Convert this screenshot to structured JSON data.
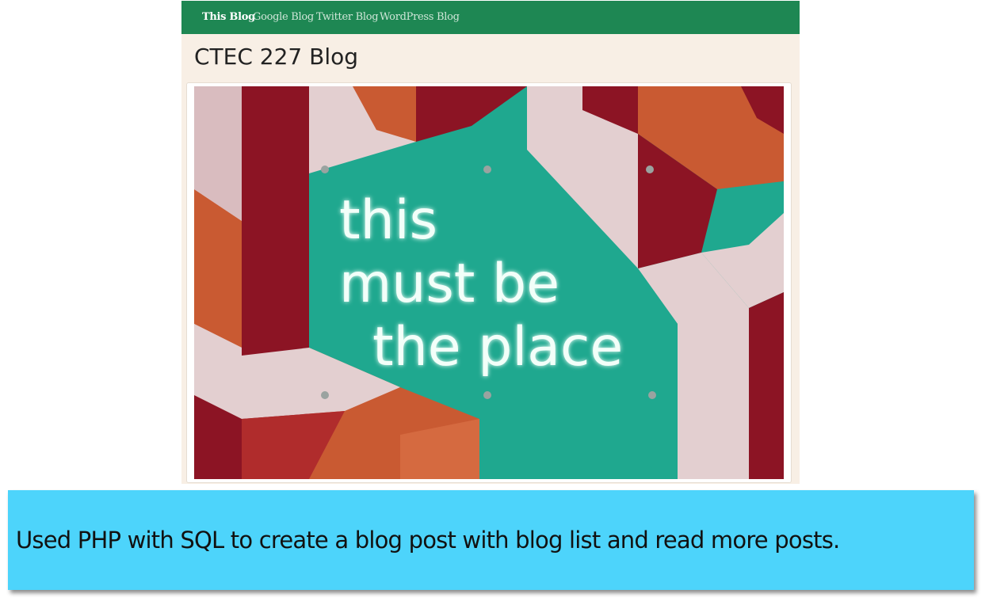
{
  "nav": {
    "items": [
      {
        "label": "This Blog",
        "active": true
      },
      {
        "label": "Google Blog",
        "active": false
      },
      {
        "label": "Twitter Blog",
        "active": false
      },
      {
        "label": "WordPress Blog",
        "active": false
      }
    ]
  },
  "header": {
    "title": "CTEC 227 Blog"
  },
  "post": {
    "image": {
      "neon_lines": [
        "this",
        "must be",
        "the place"
      ]
    }
  },
  "caption": {
    "text": "Used PHP with SQL to create a blog post with blog list and read more posts."
  },
  "colors": {
    "navbar": "#1e8753",
    "page_background": "#f8efe5",
    "caption_background": "#4dd4fb",
    "wall_teal": "#1fa88f",
    "wall_red": "#8c1424",
    "wall_orange": "#c95a32",
    "wall_pink": "#e3cfd0"
  }
}
